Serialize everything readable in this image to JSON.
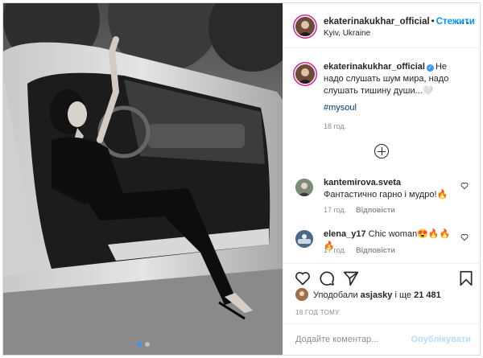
{
  "post": {
    "username": "ekaterinakukhar_official",
    "follow_label": "Стежити",
    "location": "Kyiv, Ukraine",
    "more_icon": "more-options-icon",
    "caption_text": "Не надо слушать шум мира, надо слушать тишину души...🤍",
    "hashtag": "#mysoul",
    "caption_time": "18 год."
  },
  "comments": [
    {
      "username": "kantemirova.sveta",
      "text": "Фантастично гарно і мудро!🔥",
      "time": "17 год.",
      "reply": "Відповісти"
    },
    {
      "username": "elena_y17",
      "text": "Chic woman😍🔥🔥🔥",
      "time": "17 год.",
      "reply": "Відповісти"
    }
  ],
  "likes": {
    "prefix": "Уподобали ",
    "user": "asjasky",
    "middle": " і ще ",
    "count": "21 481"
  },
  "time_ago": "18 ГОД ТОМУ",
  "add_comment": {
    "placeholder": "Додайте коментар...",
    "post_label": "Опублікувати"
  },
  "colors": {
    "accent": "#0095f6",
    "verified": "#3897f0",
    "muted": "#8e8e8e"
  }
}
